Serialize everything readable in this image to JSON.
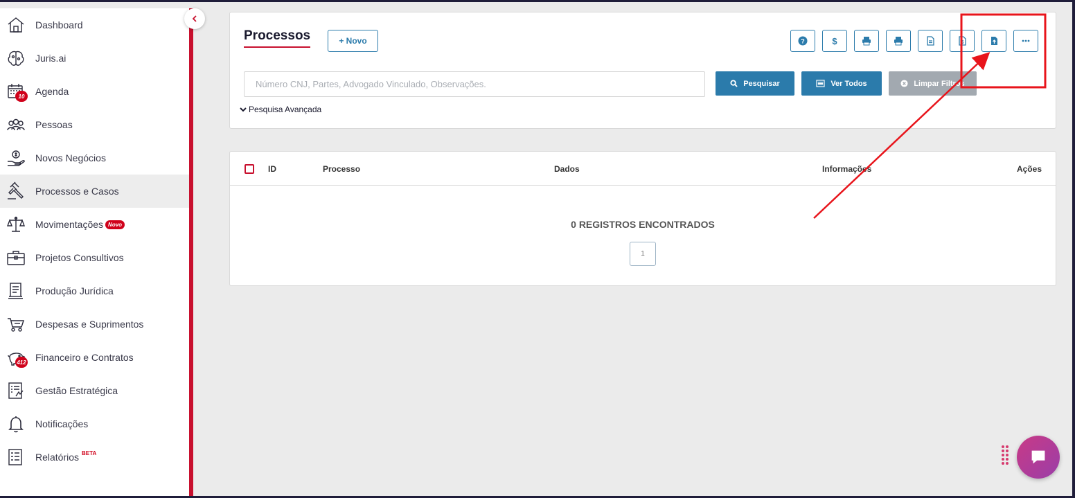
{
  "sidebar": {
    "items": [
      {
        "label": "Dashboard",
        "icon": "home-icon"
      },
      {
        "label": "Juris.ai",
        "icon": "brain-icon"
      },
      {
        "label": "Agenda",
        "icon": "calendar-icon",
        "badge": "10"
      },
      {
        "label": "Pessoas",
        "icon": "people-icon"
      },
      {
        "label": "Novos Negócios",
        "icon": "money-hand-icon"
      },
      {
        "label": "Processos e Casos",
        "icon": "gavel-icon"
      },
      {
        "label": "Movimentações",
        "icon": "scales-icon",
        "tag": "Novo"
      },
      {
        "label": "Projetos Consultivos",
        "icon": "briefcase-icon"
      },
      {
        "label": "Produção Jurídica",
        "icon": "document-stack-icon"
      },
      {
        "label": "Despesas e Suprimentos",
        "icon": "cart-icon"
      },
      {
        "label": "Financeiro e Contratos",
        "icon": "piggy-bank-icon",
        "badge": "412"
      },
      {
        "label": "Gestão Estratégica",
        "icon": "strategy-icon"
      },
      {
        "label": "Notificações",
        "icon": "bell-icon"
      },
      {
        "label": "Relatórios",
        "icon": "report-icon",
        "tag": "BETA"
      }
    ]
  },
  "header": {
    "title": "Processos",
    "new_button": "+ Novo",
    "tools": [
      "help-icon",
      "dollar-icon",
      "print-icon",
      "print-list-icon",
      "document-icon",
      "document-money-icon",
      "upload-file-icon",
      "more-icon"
    ]
  },
  "search": {
    "placeholder": "Número CNJ, Partes, Advogado Vinculado, Observações.",
    "search_button": "Pesquisar",
    "all_button": "Ver Todos",
    "clear_button": "Limpar Filtros",
    "advanced": "Pesquisa Avançada"
  },
  "table": {
    "columns": [
      "ID",
      "Processo",
      "Dados",
      "Informações",
      "Ações"
    ],
    "empty_message": "0 REGISTROS ENCONTRADOS",
    "page": "1"
  },
  "colors": {
    "accent": "#c8102e",
    "primary": "#2b7bab",
    "annotation": "#e8141b",
    "chat": "#b93c95"
  }
}
